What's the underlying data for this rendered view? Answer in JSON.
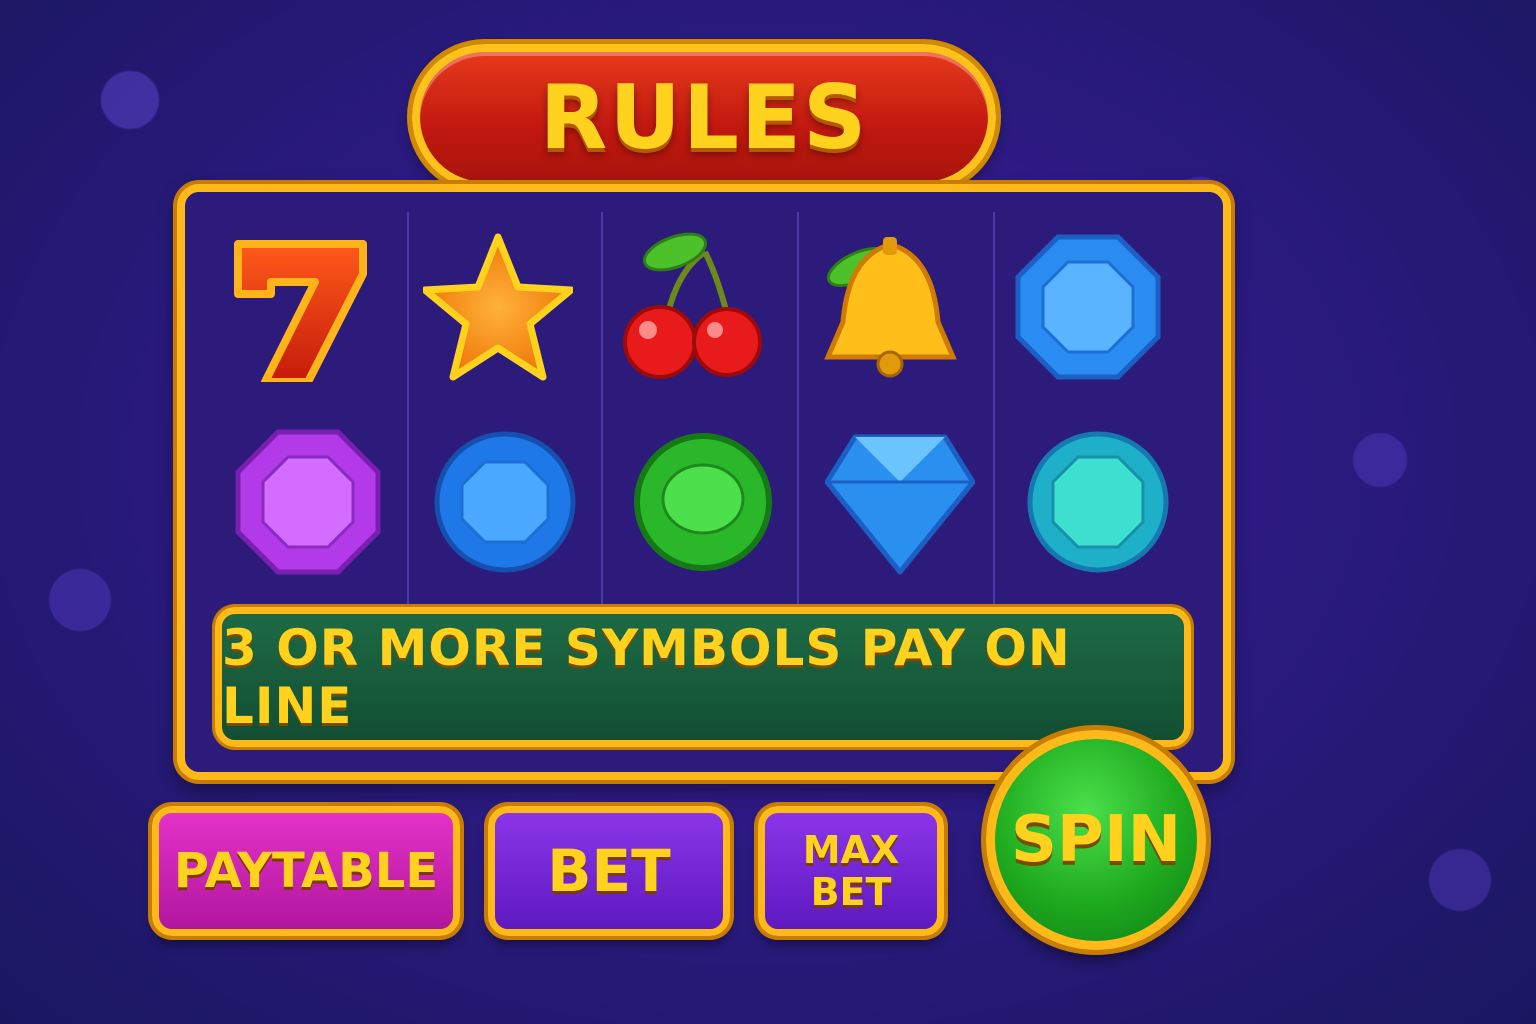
{
  "title": "RULES",
  "reels": {
    "row1": [
      "seven-icon",
      "star-icon",
      "cherry-icon",
      "bell-icon",
      "blue-gem-icon"
    ],
    "row2": [
      "purple-gem-icon",
      "blue-round-gem-icon",
      "green-gem-icon",
      "diamond-icon",
      "teal-gem-icon"
    ]
  },
  "info_text": "3 OR MORE SYMBOLS PAY ON LINE",
  "buttons": {
    "paytable": "PAYTABLE",
    "bet": "BET",
    "max_bet_line1": "MAX",
    "max_bet_line2": "BET",
    "spin": "SPIN"
  },
  "colors": {
    "gold": "#ffba1a",
    "title_red": "#c0180f",
    "info_green": "#124e33",
    "spin_green": "#1eaa1e",
    "paytable_magenta": "#b0169e",
    "bet_purple": "#5e19c0"
  }
}
